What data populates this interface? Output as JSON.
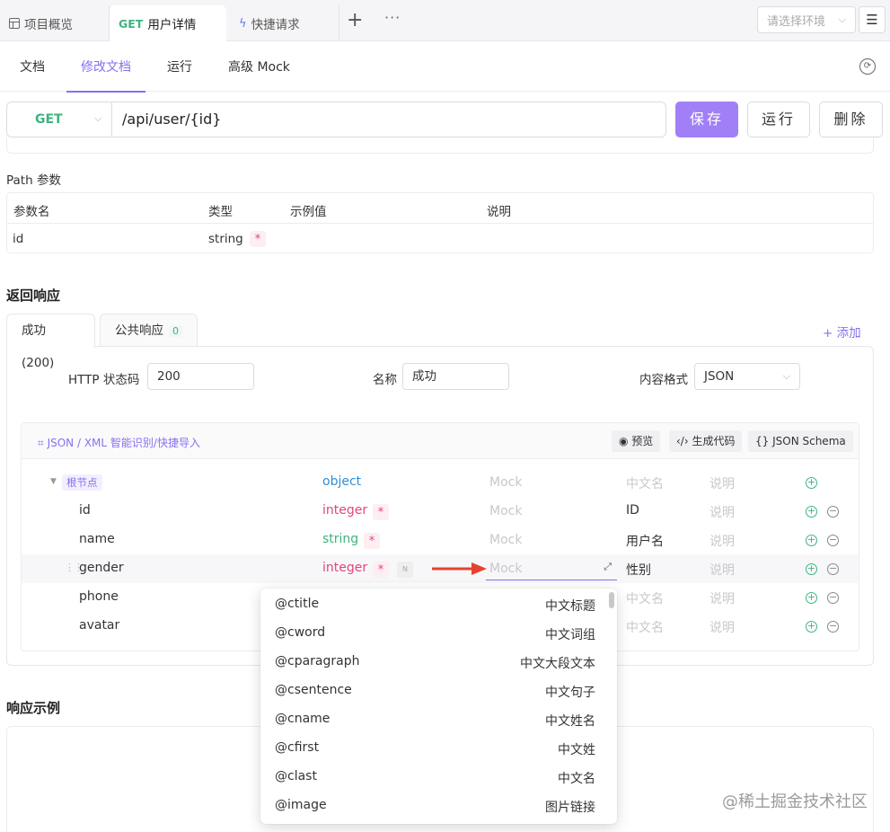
{
  "top_tabs": [
    {
      "label": "项目概览",
      "icon": "layout-icon"
    },
    {
      "method": "GET",
      "label": "用户详情"
    },
    {
      "label": "快捷请求",
      "icon": "lightning-icon"
    }
  ],
  "top_actions": {
    "plus": "+",
    "more": "···"
  },
  "env_select": {
    "placeholder": "请选择环境"
  },
  "sub_tabs": [
    "文档",
    "修改文档",
    "运行",
    "高级 Mock"
  ],
  "active_sub_tab": "修改文档",
  "request": {
    "method": "GET",
    "url": "/api/user/{id}",
    "save": "保存",
    "run": "运行",
    "delete": "删除"
  },
  "path_params": {
    "title": "Path 参数",
    "headers": [
      "参数名",
      "类型",
      "示例值",
      "说明"
    ],
    "rows": [
      {
        "name": "id",
        "type": "string",
        "required": "*"
      }
    ]
  },
  "response": {
    "title": "返回响应",
    "tabs": [
      {
        "label": "成功 (200)"
      },
      {
        "label": "公共响应",
        "count": "0"
      }
    ],
    "add": "+ 添加",
    "status_label": "HTTP 状态码",
    "status_value": "200",
    "name_label": "名称",
    "name_value": "成功",
    "format_label": "内容格式",
    "format_value": "JSON",
    "schema_toolbar": {
      "smart_import": "JSON / XML 智能识别/快捷导入",
      "preview": "预览",
      "gen_code": "生成代码",
      "json_schema": "JSON Schema"
    },
    "schema_rows": [
      {
        "name": "根节点",
        "type": "object",
        "mock": "Mock",
        "cn": "中文名",
        "desc": "说明"
      },
      {
        "name": "id",
        "type": "integer",
        "mock": "Mock",
        "cn": "ID",
        "desc": "说明"
      },
      {
        "name": "name",
        "type": "string",
        "mock": "Mock",
        "cn": "用户名",
        "desc": "说明"
      },
      {
        "name": "gender",
        "type": "integer",
        "mock": "Mock",
        "cn": "性别",
        "desc": "说明"
      },
      {
        "name": "phone",
        "cn": "中文名",
        "desc": "说明"
      },
      {
        "name": "avatar",
        "cn": "中文名",
        "desc": "说明"
      }
    ],
    "required_mark": "*"
  },
  "example": {
    "title": "响应示例"
  },
  "mock_dropdown": [
    {
      "key": "@ctitle",
      "label": "中文标题"
    },
    {
      "key": "@cword",
      "label": "中文词组"
    },
    {
      "key": "@cparagraph",
      "label": "中文大段文本"
    },
    {
      "key": "@csentence",
      "label": "中文句子"
    },
    {
      "key": "@cname",
      "label": "中文姓名"
    },
    {
      "key": "@cfirst",
      "label": "中文姓"
    },
    {
      "key": "@clast",
      "label": "中文名"
    },
    {
      "key": "@image",
      "label": "图片链接"
    }
  ],
  "watermark": "@稀土掘金技术社区",
  "colors": {
    "accent": "#a180f7",
    "get": "#3fb37f",
    "integer": "#e2467b",
    "string": "#3fb37f",
    "object": "#2f8fd8",
    "arrow": "#e8402d"
  }
}
